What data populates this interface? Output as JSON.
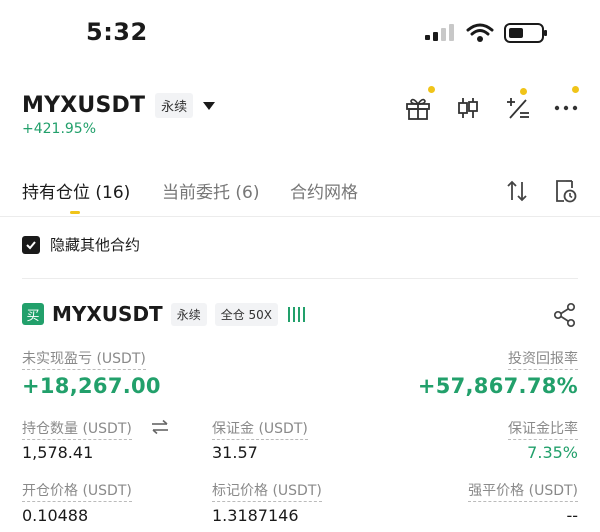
{
  "status_bar": {
    "time": "5:32"
  },
  "header": {
    "symbol": "MYXUSDT",
    "perp_tag": "永续",
    "change": "+421.95%"
  },
  "tabs": [
    {
      "label": "持有仓位 (16)",
      "active": true
    },
    {
      "label": "当前委托 (6)",
      "active": false
    },
    {
      "label": "合约网格",
      "active": false
    }
  ],
  "hide_other": {
    "label": "隐藏其他合约",
    "checked": true
  },
  "position": {
    "side_badge": "买",
    "symbol": "MYXUSDT",
    "perp_tag": "永续",
    "margin_tag": "全仓 50X",
    "unrealized_label": "未实现盈亏 (USDT)",
    "unrealized_value": "+18,267.00",
    "roi_label": "投资回报率",
    "roi_value": "+57,867.78%",
    "qty_label": "持仓数量 (USDT)",
    "qty_value": "1,578.41",
    "margin_label": "保证金 (USDT)",
    "margin_value": "31.57",
    "margin_ratio_label": "保证金比率",
    "margin_ratio_value": "7.35%",
    "entry_label": "开仓价格 (USDT)",
    "entry_value": "0.10488",
    "mark_label": "标记价格 (USDT)",
    "mark_value": "1.3187146",
    "liq_label": "强平价格 (USDT)",
    "liq_value": "--"
  },
  "colors": {
    "green": "#22a06b",
    "accent": "#f0c419"
  }
}
